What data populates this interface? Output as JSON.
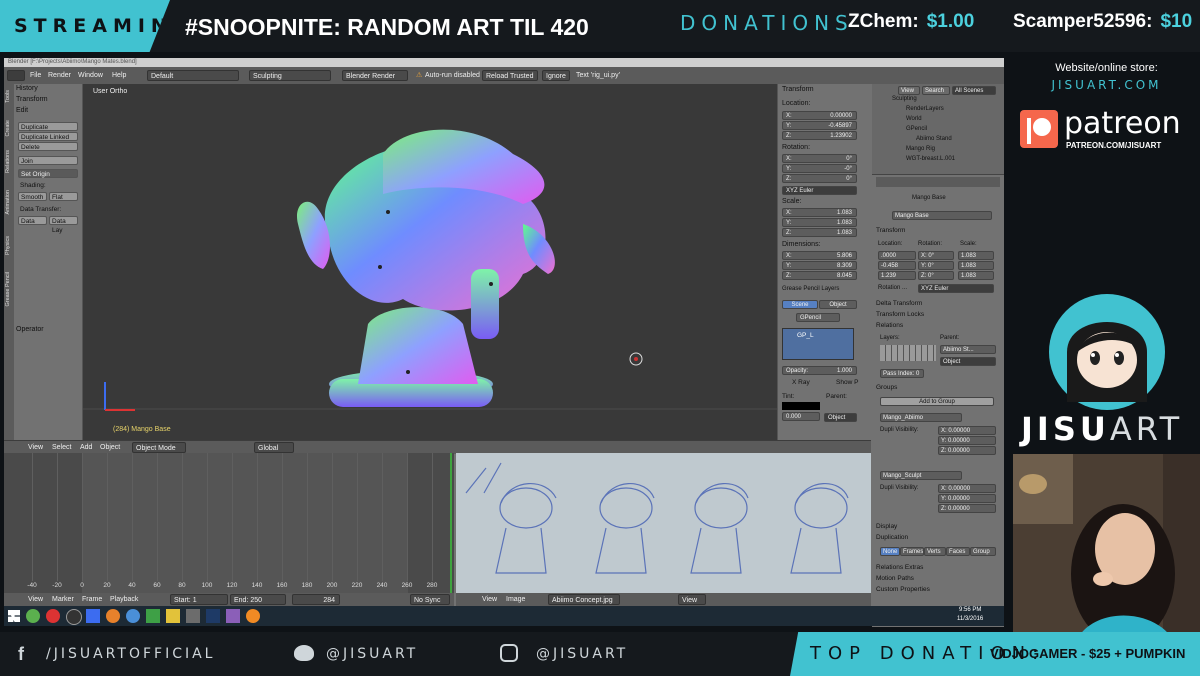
{
  "overlay": {
    "streaming_label": "STREAMING:",
    "stream_title": "#SNOOPNITE: RANDOM ART TIL 420",
    "donations_label": "DONATIONS",
    "donations": [
      {
        "name": "ZChem:",
        "amount": "$1.00"
      },
      {
        "name": "Scamper52596:",
        "amount": "$10"
      }
    ],
    "store_heading": "Website/online store:",
    "store_url": "JISUART.COM",
    "patreon_name": "patreon",
    "patreon_url": "PATREON.COM/JISUART",
    "brand_bold": "JISU",
    "brand_light": "ART",
    "socials": {
      "facebook": "/JISUARTOFFICIAL",
      "twitter": "@JISUART",
      "instagram": "@JISUART"
    },
    "top_donation_label": "TOP DONATION:",
    "top_donation_value": "VIDJOGAMER - $25 + PUMPKIN"
  },
  "blender": {
    "title": "Blender [F:\\Projects\\Abiimo\\Mango Mates.blend]",
    "menu": [
      "File",
      "Render",
      "Window",
      "Help"
    ],
    "layout": "Default",
    "scene": "Sculpting",
    "engine": "Blender Render",
    "autorun": "Auto-run disabled",
    "reload": "Reload Trusted",
    "ignore": "Ignore",
    "text_status": "Text 'rig_ui.py'",
    "toolshelf": {
      "tabs": [
        "Tools",
        "Create",
        "Relations",
        "Animation",
        "Physics",
        "Grease Pencil"
      ],
      "history": "History",
      "transform": "Transform",
      "edit": "Edit",
      "buttons": [
        "Duplicate",
        "Duplicate Linked",
        "Delete",
        "Join"
      ],
      "set_origin": "Set Origin",
      "shading": "Shading:",
      "smooth": "Smooth",
      "flat": "Flat",
      "data_transfer": "Data Transfer:",
      "data": "Data",
      "data_lay": "Data Lay",
      "operator": "Operator"
    },
    "viewport": {
      "label": "User Ortho",
      "selected": "(284) Mango Base"
    },
    "npanel": {
      "transform": "Transform",
      "location": "Location:",
      "loc": [
        {
          "axis": "X:",
          "value": "0.00000"
        },
        {
          "axis": "Y:",
          "value": "-0.45897"
        },
        {
          "axis": "Z:",
          "value": "1.23902"
        }
      ],
      "rotation": "Rotation:",
      "rot": [
        {
          "axis": "X:",
          "value": "0°"
        },
        {
          "axis": "Y:",
          "value": "-0°"
        },
        {
          "axis": "Z:",
          "value": "0°"
        }
      ],
      "euler": "XYZ Euler",
      "scale": "Scale:",
      "scl": [
        {
          "axis": "X:",
          "value": "1.083"
        },
        {
          "axis": "Y:",
          "value": "1.083"
        },
        {
          "axis": "Z:",
          "value": "1.083"
        }
      ],
      "dimensions": "Dimensions:",
      "dim": [
        {
          "axis": "X:",
          "value": "5.806"
        },
        {
          "axis": "Y:",
          "value": "8.309"
        },
        {
          "axis": "Z:",
          "value": "8.045"
        }
      ],
      "grease": "Grease Pencil Layers",
      "scene_tab": "Scene",
      "object_tab": "Object",
      "gpencil": "GPencil",
      "gp_layer": "GP_L",
      "opacity": "Opacity:",
      "opacity_value": "1.000",
      "xray": "X Ray",
      "show_p": "Show P",
      "tint": "Tint:",
      "parent": "Parent:",
      "tint_value": "0.000",
      "object": "Object"
    },
    "outliner": {
      "tabs": [
        "View",
        "Search",
        "All Scenes"
      ],
      "items": [
        "Sculpting",
        "RenderLayers",
        "World",
        "GPencil",
        "Abiimo Stand",
        "Mango Rig",
        "WGT-breast.L.001"
      ]
    },
    "props": {
      "object_name": "Mango Base",
      "transform": "Transform",
      "location": "Location:",
      "rotation": "Rotation:",
      "scale": "Scale:",
      "loc": [
        ".0000",
        "-0.458",
        "1.239"
      ],
      "rot": [
        "X: 0°",
        "Y: 0°",
        "Z: 0°"
      ],
      "scl": [
        "1.083",
        "1.083",
        "1.083"
      ],
      "rotation_mode": "Rotation ...",
      "euler": "XYZ Euler",
      "delta": "Delta Transform",
      "locks": "Transform Locks",
      "relations": "Relations",
      "layers": "Layers:",
      "parent": "Parent:",
      "parent_value": "Abiimo St...",
      "object": "Object",
      "pass_index": "Pass Index:",
      "pass_value": "0",
      "groups": "Groups",
      "add_group": "Add to Group",
      "group1": "Mango_Abiimo",
      "group2": "Mango_Sculpt",
      "dupli_vis": "Dupli Visibility:",
      "offsets": [
        "X: 0.00000",
        "Y: 0.00000",
        "Z: 0.00000"
      ],
      "display": "Display",
      "duplication": "Duplication",
      "dup_tabs": [
        "None",
        "Frames",
        "Verts",
        "Faces",
        "Group"
      ],
      "relations_extras": "Relations Extras",
      "motion_paths": "Motion Paths",
      "custom_props": "Custom Properties"
    },
    "vp_header": {
      "view": "View",
      "select": "Select",
      "add": "Add",
      "object": "Object",
      "mode": "Object Mode",
      "pivot": "Global"
    },
    "timeline": {
      "ticks": [
        "-40",
        "-20",
        "0",
        "20",
        "40",
        "60",
        "80",
        "100",
        "120",
        "140",
        "160",
        "180",
        "200",
        "220",
        "240",
        "260",
        "280"
      ]
    },
    "tl_footer": {
      "view": "View",
      "marker": "Marker",
      "frame": "Frame",
      "playback": "Playback",
      "start": "Start:",
      "start_v": "1",
      "end": "End:",
      "end_v": "250",
      "current": "284",
      "sync": "No Sync"
    },
    "img_footer": {
      "view": "View",
      "image": "Image",
      "file": "Abiimo Concept.jpg",
      "view2": "View"
    },
    "taskbar": {
      "time": "9:56 PM",
      "date": "11/3/2016"
    }
  }
}
